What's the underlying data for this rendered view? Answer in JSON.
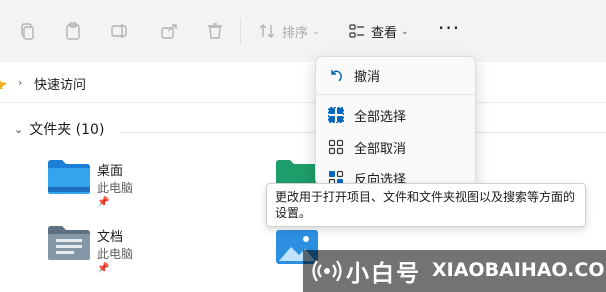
{
  "toolbar": {
    "sort_label": "排序",
    "view_label": "查看",
    "more_label": "···"
  },
  "address": {
    "quick_access": "快速访问"
  },
  "content": {
    "group_header": "文件夹 (10)",
    "items": [
      {
        "name": "桌面",
        "location": "此电脑"
      },
      {
        "name": "文档",
        "location": "此电脑"
      }
    ]
  },
  "menu": {
    "items": [
      {
        "label": "撤消"
      },
      {
        "label": "全部选择"
      },
      {
        "label": "全部取消"
      },
      {
        "label": "反向选择"
      }
    ]
  },
  "tooltip": {
    "text": "更改用于打开项目、文件和文件夹视图以及搜索等方面的设置。"
  },
  "watermark": {
    "brand_cn": "小白号",
    "brand_url": "XIAOBAIHAO.COM"
  },
  "colors": {
    "accent": "#0067c0",
    "folder_blue": "#2c8fe0",
    "folder_green": "#1e9e6a"
  }
}
